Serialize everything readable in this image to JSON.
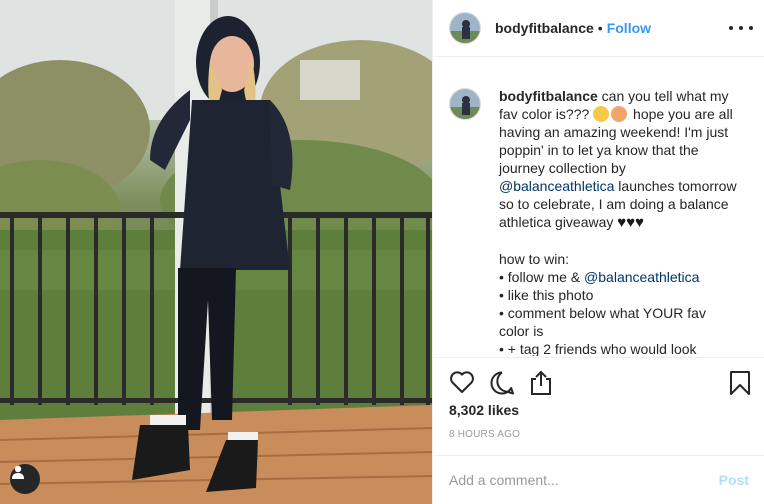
{
  "post": {
    "username": "bodyfitbalance",
    "separator": "•",
    "follow_label": "Follow",
    "more_icon": "more-horizontal-icon"
  },
  "caption": {
    "username": "bodyfitbalance",
    "line1": " can you tell what my fav color is??? ",
    "line2": " hope you are all having an amazing weekend! I'm just poppin' in to let ya know that the journey collection by ",
    "mention1": "@balanceathletica",
    "line3": " launches tomorrow so to celebrate, I am doing a balance athletica giveaway ",
    "how_to": "how to win:",
    "bullet1_prefix": "• follow me & ",
    "mention2": "@balanceathletica",
    "bullet2": "• like this photo",
    "bullet3": "• comment below what YOUR fav color is",
    "bullet4": "• + tag 2 friends who would look"
  },
  "actions": {
    "like_icon": "heart-icon",
    "comment_icon": "comment-icon",
    "share_icon": "share-icon",
    "save_icon": "bookmark-icon"
  },
  "likes": "8,302 likes",
  "timestamp": "8 HOURS AGO",
  "comment": {
    "placeholder": "Add a comment...",
    "post_label": "Post"
  },
  "colors": {
    "accent": "#3897f0",
    "post_disabled": "#b2dffc",
    "mention": "#003569"
  }
}
